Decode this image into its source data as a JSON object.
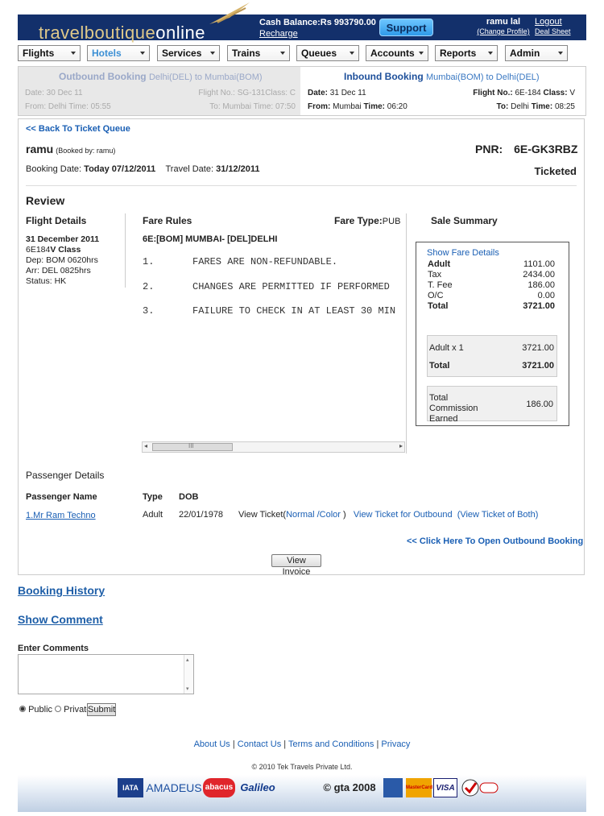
{
  "header": {
    "logo_travel": "travelboutique",
    "logo_online": "online",
    "cash_label": "Cash Balance:Rs 993790.00",
    "recharge": "Recharge",
    "support": "Support",
    "user_name": "ramu  lal",
    "change_profile": "(Change Profile)",
    "logout": "Logout",
    "deal_sheet": "Deal Sheet"
  },
  "nav": [
    "Flights",
    "Hotels",
    "Services",
    "Trains",
    "Queues",
    "Accounts",
    "Reports",
    "Admin"
  ],
  "nav_active": "Hotels",
  "outbound": {
    "title": "Outbound Booking",
    "route": "Delhi(DEL) to Mumbai(BOM)",
    "date": "Date: 30 Dec 11",
    "flight": "Flight No.: SG-131Class: C",
    "from": "From: Delhi Time: 05:55",
    "to": "To: Mumbai Time: 07:50"
  },
  "inbound": {
    "title": "Inbound Booking",
    "route": "Mumbai(BOM) to Delhi(DEL)",
    "date_label": "Date:",
    "date": "31 Dec 11",
    "flight_label": "Flight No.:",
    "flight": "6E-184",
    "class_label": "Class:",
    "class": "V",
    "from_label": "From:",
    "from": "Mumbai",
    "from_time_label": "Time:",
    "from_time": "06:20",
    "to_label": "To:",
    "to": "Delhi",
    "to_time_label": "Time:",
    "to_time": "08:25"
  },
  "main": {
    "back_link": "<< Back To Ticket Queue",
    "booker": "ramu",
    "booked_by": "(Booked by: ramu)",
    "pnr_label": "PNR:",
    "pnr": "6E-GK3RBZ",
    "booking_date_label": "Booking Date:",
    "booking_date": "Today 07/12/2011",
    "travel_date_label": "Travel Date:",
    "travel_date": "31/12/2011",
    "status": "Ticketed",
    "review": "Review"
  },
  "flight_details": {
    "heading": "Flight Details",
    "date": "31 December 2011",
    "flight_no": "6E184",
    "class": "V Class",
    "dep": "Dep: BOM 0620hrs",
    "arr": "Arr: DEL 0825hrs",
    "status": "Status: HK"
  },
  "fare_rules": {
    "heading": "Fare Rules",
    "fare_type_label": "Fare Type:",
    "fare_type": "PUB",
    "route": "6E:[BOM] MUMBAI- [DEL]DELHI",
    "rules": [
      {
        "num": "1.",
        "text": "FARES ARE NON-REFUNDABLE."
      },
      {
        "num": "2.",
        "text": "CHANGES ARE PERMITTED IF PERFORMED"
      },
      {
        "num": "3.",
        "text": "FAILURE TO CHECK IN AT LEAST 30 MIN"
      }
    ],
    "scroll_mid": "III"
  },
  "sale_summary": {
    "heading": "Sale Summary",
    "show_details": "Show Fare Details",
    "rows": [
      {
        "label": "Adult",
        "value": "1101.00",
        "bold": true
      },
      {
        "label": "Tax",
        "value": "2434.00",
        "bold": false
      },
      {
        "label": "T. Fee",
        "value": "186.00",
        "bold": false
      },
      {
        "label": "O/C",
        "value": "0.00",
        "bold": false
      },
      {
        "label": "Total",
        "value": "3721.00",
        "bold": true
      }
    ],
    "adult_x": "Adult x 1",
    "adult_x_value": "3721.00",
    "total_label": "Total",
    "total_value": "3721.00",
    "commission_label": "Total Commission Earned",
    "commission_value": "186.00"
  },
  "passengers": {
    "heading": "Passenger Details",
    "col_name": "Passenger Name",
    "col_type": "Type",
    "col_dob": "DOB",
    "rows": [
      {
        "name": "1.Mr Ram Techno",
        "type": "Adult",
        "dob": "22/01/1978"
      }
    ],
    "view_ticket": "View Ticket(",
    "normal": "Normal",
    "color": "/Color",
    "close_paren": " )",
    "view_outbound": "View Ticket for Outbound",
    "view_both": "(View Ticket of Both)",
    "open_outbound": "<< Click Here To Open Outbound Booking",
    "view_invoice": "View Invoice"
  },
  "history": {
    "booking_history": "Booking History",
    "show_comment": "Show Comment",
    "enter_comments": "Enter Comments",
    "public": "Public",
    "private": "Private",
    "submit": "Submit"
  },
  "footer": {
    "about": "About Us",
    "contact": "Contact Us",
    "terms": "Terms and Conditions",
    "privacy": "Privacy",
    "sep": "|",
    "copyright": "© 2010 Tek Travels Private Ltd.",
    "partners": [
      "IATA",
      "AMADEUS",
      "abacus",
      "Galileo",
      "© gta 2008",
      "VISA",
      "MasterCard"
    ]
  }
}
